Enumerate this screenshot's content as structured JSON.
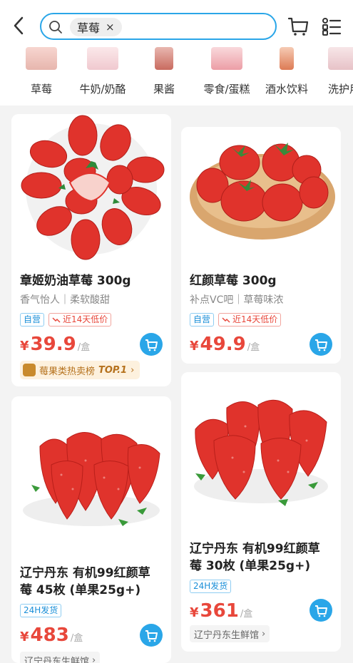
{
  "search": {
    "query_chip": "草莓",
    "chip_close": "×"
  },
  "categories": [
    {
      "label": "草莓"
    },
    {
      "label": "牛奶/奶酪"
    },
    {
      "label": "果酱"
    },
    {
      "label": "零食/蛋糕"
    },
    {
      "label": "酒水饮料"
    },
    {
      "label": "洗护用"
    }
  ],
  "products": [
    {
      "title": "章姬奶油草莓 300g",
      "subtitle": "香气怡人｜柔软酸甜",
      "tag_self": "自营",
      "tag_low": "近14天低价",
      "currency": "¥",
      "price": "39.9",
      "unit": "/盒",
      "rank_text": "莓果类热卖榜",
      "rank_top": "TOP.1",
      "rank_arrow": "›"
    },
    {
      "title": "红颜草莓 300g",
      "subtitle": "补点VC吧｜草莓味浓",
      "tag_self": "自营",
      "tag_low": "近14天低价",
      "currency": "¥",
      "price": "49.9",
      "unit": "/盒"
    },
    {
      "title_line1": "辽宁丹东 有机99红颜草",
      "title_line2": "莓 45枚 (单果25g+)",
      "tag_24": "24H发货",
      "currency": "¥",
      "price": "483",
      "unit": "/盒",
      "shop": "辽宁丹东生鲜馆",
      "shop_arrow": "›"
    },
    {
      "title_line1": "辽宁丹东 有机99红颜草",
      "title_line2": "莓 30枚 (单果25g+)",
      "tag_24": "24H发货",
      "currency": "¥",
      "price": "361",
      "unit": "/盒",
      "shop": "辽宁丹东生鲜馆",
      "shop_arrow": "›"
    }
  ],
  "colors": {
    "accent": "#2aa6e8",
    "price": "#e8473b",
    "strawberry": "#e0332c"
  }
}
